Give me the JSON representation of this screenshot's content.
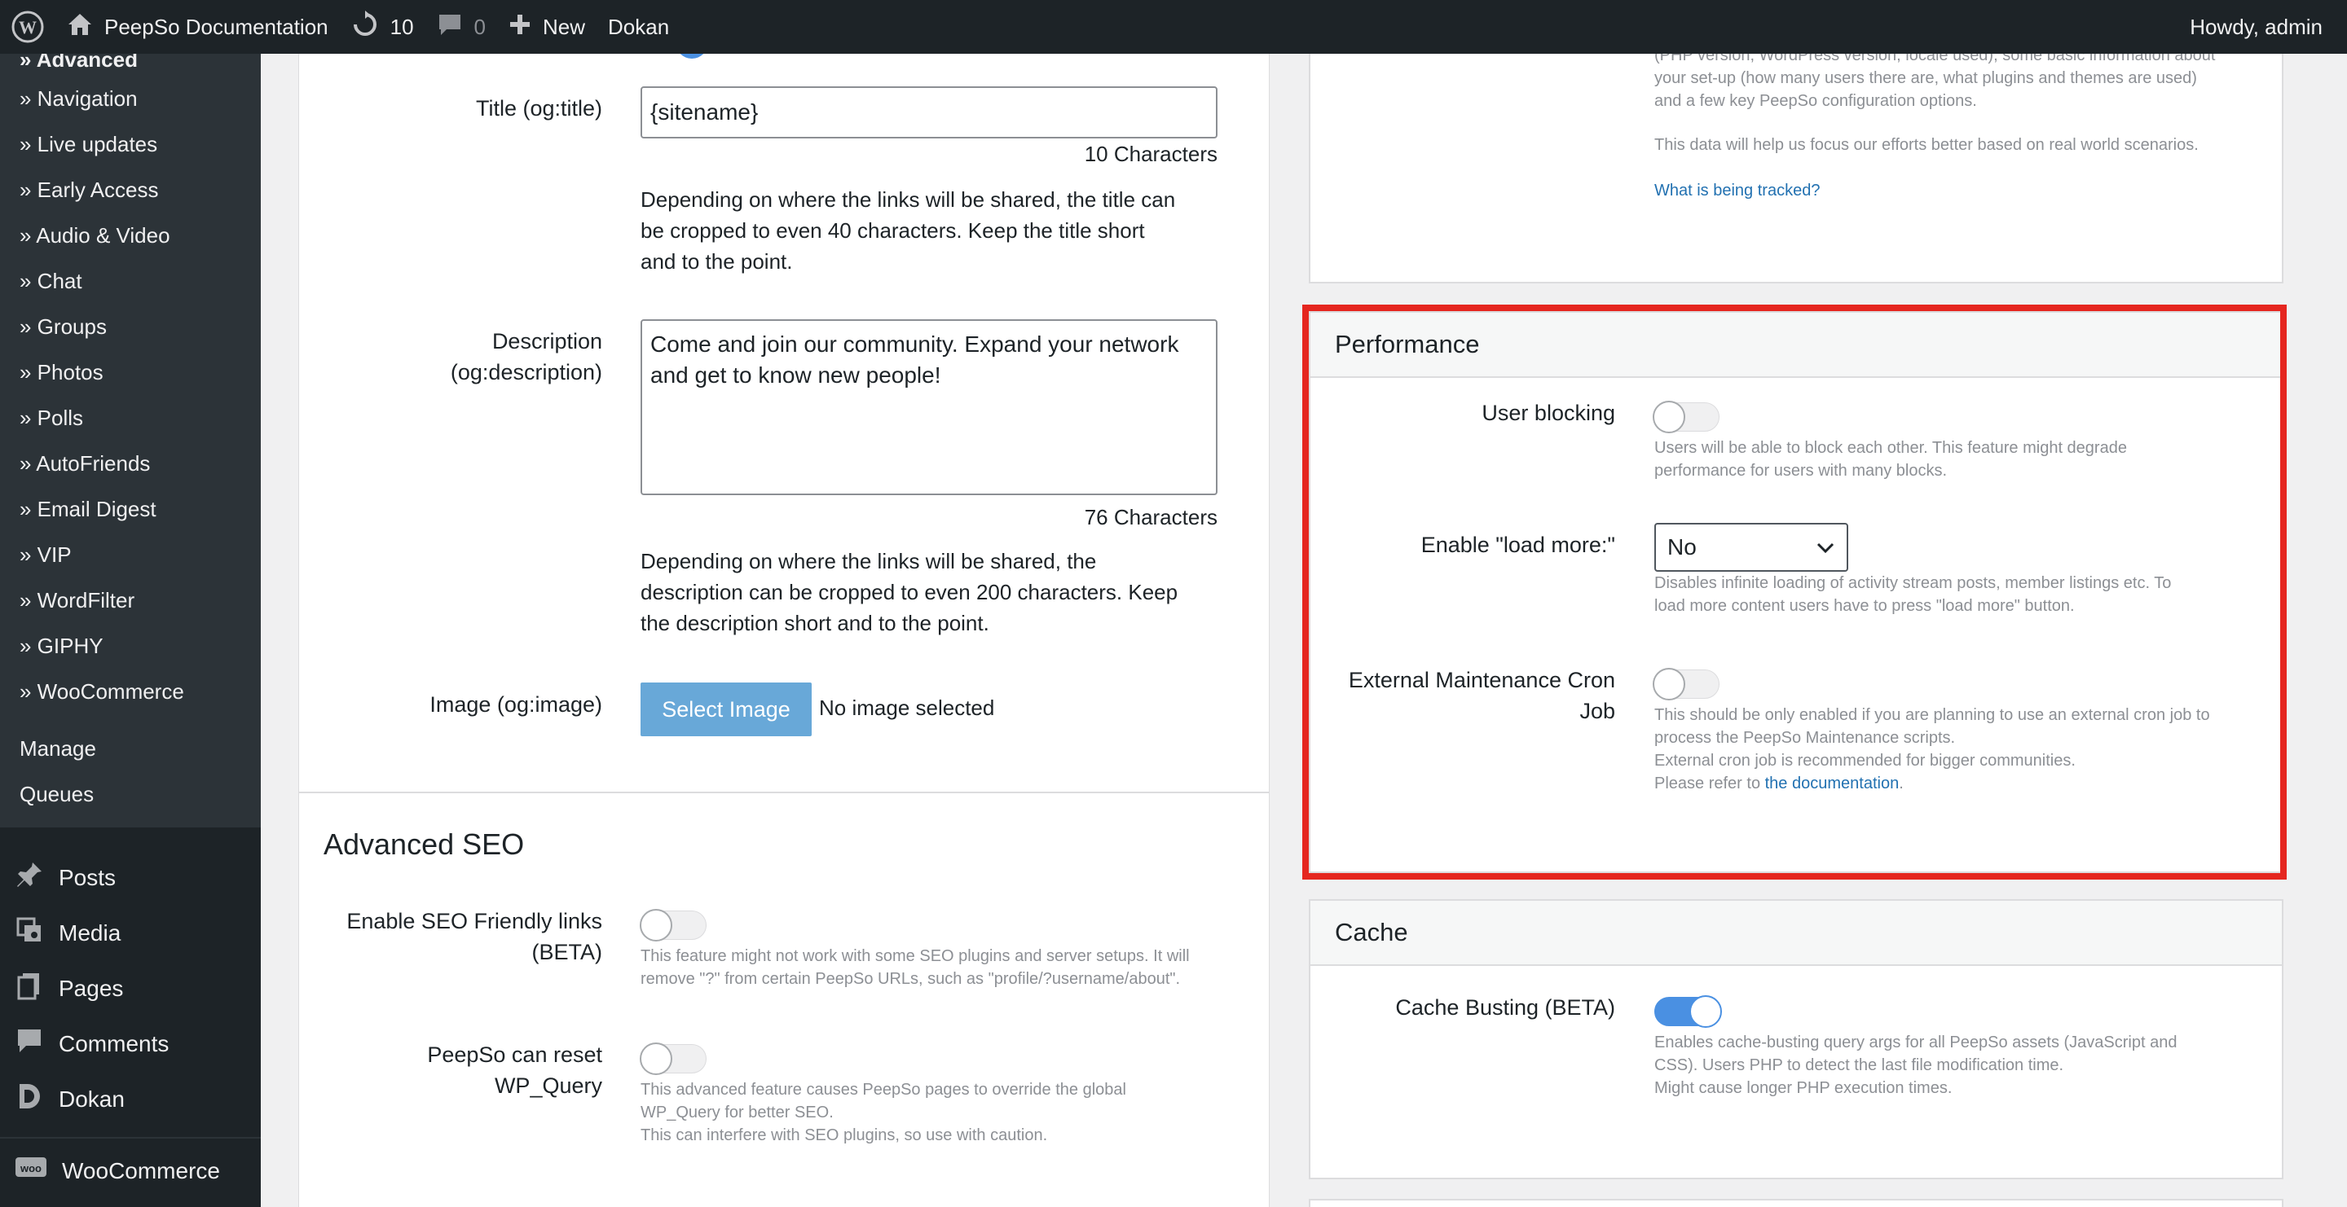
{
  "adminbar": {
    "site_name": "PeepSo Documentation",
    "updates_count": "10",
    "comments_count": "0",
    "new_label": "New",
    "dokan_label": "Dokan",
    "howdy": "Howdy, admin"
  },
  "sidebar": {
    "submenu": [
      "» Advanced",
      "» Navigation",
      "» Live updates",
      "» Early Access",
      "» Audio & Video",
      "» Chat",
      "» Groups",
      "» Photos",
      "» Polls",
      "» AutoFriends",
      "» Email Digest",
      "» VIP",
      "» WordFilter",
      "» GIPHY",
      "» WooCommerce"
    ],
    "manage": "Manage",
    "queues": "Queues",
    "main": [
      "Posts",
      "Media",
      "Pages",
      "Comments",
      "Dokan",
      "WooCommerce"
    ]
  },
  "left": {
    "og_title_label": "Title (og:title)",
    "og_title_value": "{sitename}",
    "og_title_count": "10 Characters",
    "og_title_help": [
      "Depending on where the links will be shared, the title can",
      "be cropped to even 40 characters. Keep the title short",
      "and to the point."
    ],
    "og_desc_label_1": "Description",
    "og_desc_label_2": "(og:description)",
    "og_desc_value": "Come and join our community. Expand your network and get to know new people!",
    "og_desc_count": "76 Characters",
    "og_desc_help": [
      "Depending on where the links will be shared, the",
      "description can be cropped to even 200 characters. Keep",
      "the description short and to the point."
    ],
    "og_image_label": "Image (og:image)",
    "select_image": "Select Image",
    "no_image": "No image selected",
    "advanced_seo_title": "Advanced SEO",
    "seo_links_label_1": "Enable SEO Friendly links",
    "seo_links_label_2": "(BETA)",
    "seo_links_help": [
      "This feature might not work with some SEO plugins and server setups. It will",
      "remove \"?\" from certain PeepSo URLs, such as \"profile/?username/about\"."
    ],
    "reset_wpq_label_1": "PeepSo can reset",
    "reset_wpq_label_2": "WP_Query",
    "reset_wpq_help": [
      "This advanced feature causes PeepSo pages to override the global",
      "WP_Query for better SEO.",
      "This can interfere with SEO plugins, so use with caution."
    ]
  },
  "right": {
    "tracking_text": [
      "(PHP version, WordPress version, locale used), some basic information about",
      "your set-up (how many users there are, what plugins and themes are used)",
      "and a few key PeepSo configuration options."
    ],
    "tracking_help": "This data will help us focus our efforts better based on real world scenarios.",
    "tracking_link": "What is being tracked?",
    "performance": {
      "title": "Performance",
      "user_blocking_label": "User blocking",
      "user_blocking_help": [
        "Users will be able to block each other. This feature might degrade",
        "performance for users with many blocks."
      ],
      "load_more_label": "Enable \"load more:\"",
      "load_more_value": "No",
      "load_more_help": [
        "Disables infinite loading of activity stream posts, member listings etc. To",
        "load more content users have to press \"load more\" button."
      ],
      "cron_label_1": "External Maintenance Cron",
      "cron_label_2": "Job",
      "cron_help_1": "This should be only enabled if you are planning to use an external cron job to",
      "cron_help_2": "process the PeepSo Maintenance scripts.",
      "cron_help_3": "External cron job is recommended for bigger communities.",
      "cron_help_4_pre": "Please refer to ",
      "cron_help_4_link": "the documentation",
      "cron_help_4_post": "."
    },
    "cache": {
      "title": "Cache",
      "busting_label": "Cache Busting (BETA)",
      "busting_help": [
        "Enables cache-busting query args for all PeepSo assets (JavaScript and",
        "CSS). Users PHP to detect the last file modification time.",
        "Might cause longer PHP execution times."
      ]
    }
  },
  "colors": {
    "adminbar_bg": "#1d2327",
    "highlight": "#e5261f",
    "toggle_on": "#4a90e2",
    "link": "#2271b1"
  }
}
